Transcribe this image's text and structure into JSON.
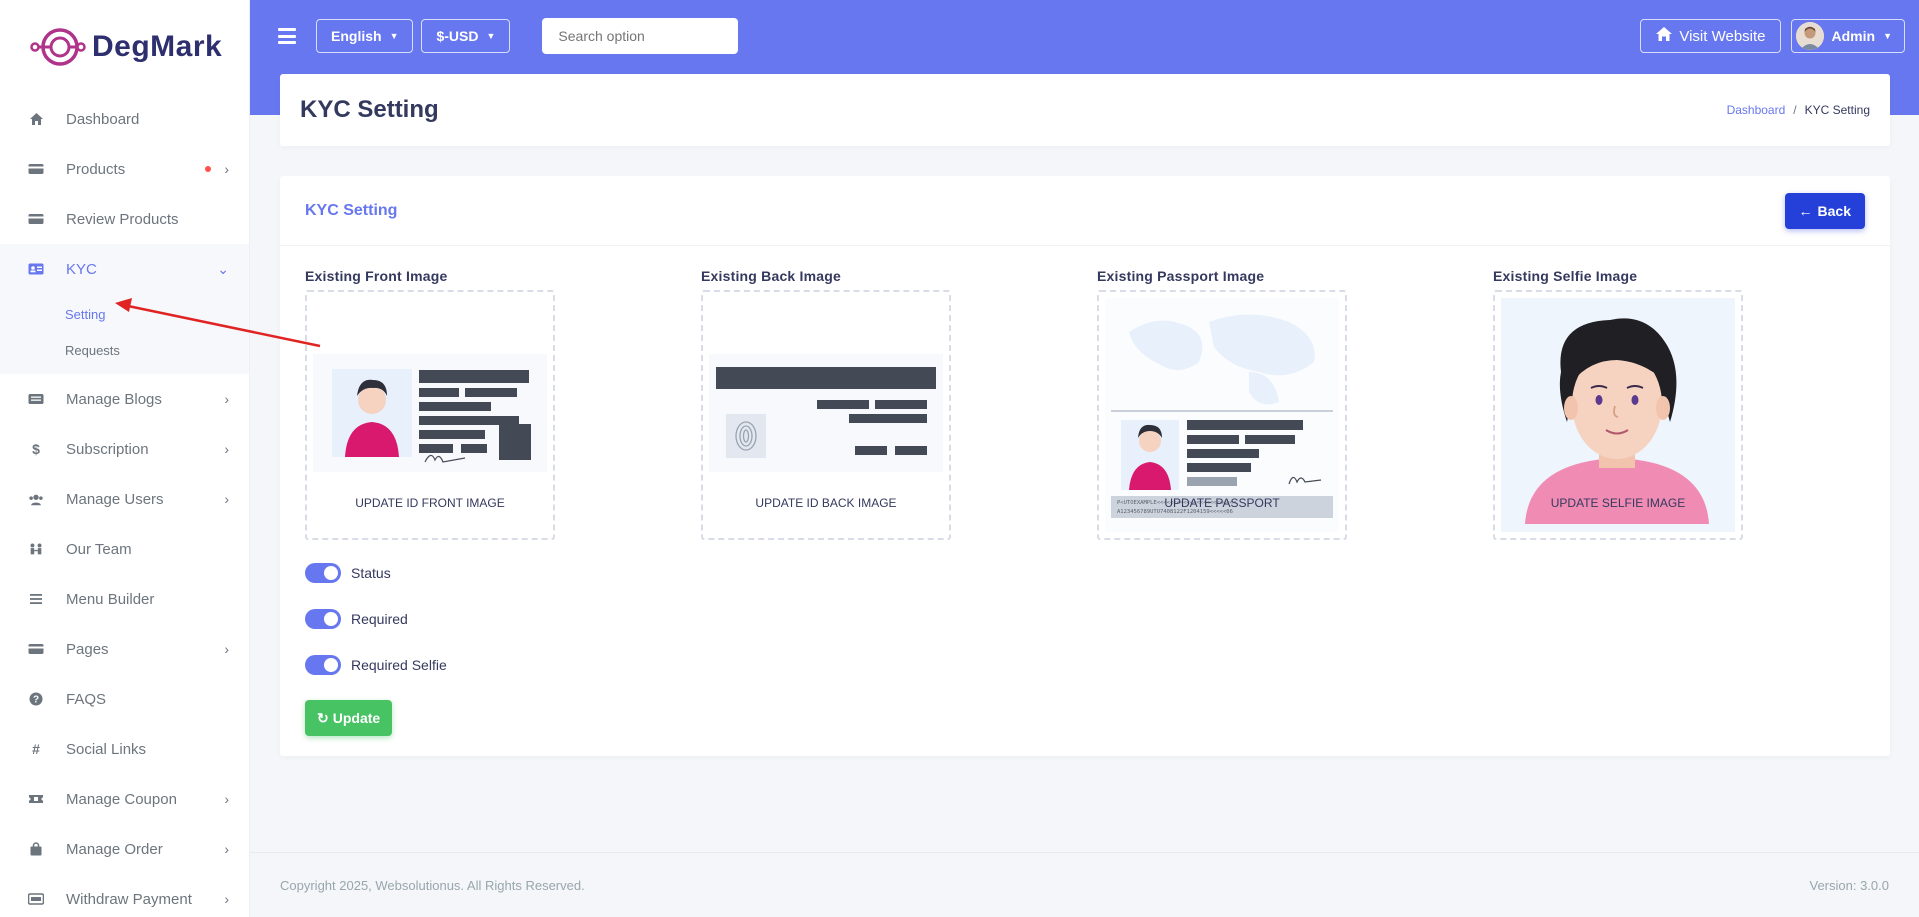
{
  "brand": {
    "name": "DegMark"
  },
  "sidebar": {
    "items": [
      {
        "label": "Dashboard",
        "icon": "home-icon"
      },
      {
        "label": "Products",
        "icon": "card-icon",
        "has_children": true,
        "dot": true
      },
      {
        "label": "Review Products",
        "icon": "card-icon"
      },
      {
        "label": "KYC",
        "icon": "id-card-icon",
        "active": true,
        "expanded": true
      },
      {
        "label": "Manage Blogs",
        "icon": "card-icon",
        "has_children": true
      },
      {
        "label": "Subscription",
        "icon": "dollar-icon",
        "has_children": true
      },
      {
        "label": "Manage Users",
        "icon": "users-icon",
        "has_children": true
      },
      {
        "label": "Our Team",
        "icon": "team-icon"
      },
      {
        "label": "Menu Builder",
        "icon": "bars-icon"
      },
      {
        "label": "Pages",
        "icon": "card-icon",
        "has_children": true
      },
      {
        "label": "FAQS",
        "icon": "question-icon"
      },
      {
        "label": "Social Links",
        "icon": "hash-icon"
      },
      {
        "label": "Manage Coupon",
        "icon": "ticket-icon",
        "has_children": true
      },
      {
        "label": "Manage Order",
        "icon": "bag-icon",
        "has_children": true
      },
      {
        "label": "Withdraw Payment",
        "icon": "wallet-icon",
        "has_children": true
      }
    ],
    "kyc_sub": [
      {
        "label": "Setting",
        "current": true
      },
      {
        "label": "Requests"
      }
    ]
  },
  "navbar": {
    "language": "English",
    "currency": "$-USD",
    "search_placeholder": "Search option",
    "visit_label": "Visit Website",
    "user_label": "Admin"
  },
  "page": {
    "title": "KYC Setting",
    "breadcrumb": {
      "home": "Dashboard",
      "current": "KYC Setting"
    }
  },
  "card": {
    "title": "KYC Setting",
    "back_label": "Back",
    "images": [
      {
        "label": "Existing Front Image",
        "caption": "UPDATE ID FRONT IMAGE"
      },
      {
        "label": "Existing Back Image",
        "caption": "UPDATE ID BACK IMAGE"
      },
      {
        "label": "Existing Passport Image",
        "caption": "UPDATE PASSPORT"
      },
      {
        "label": "Existing Selfie Image",
        "caption": "UPDATE SELFIE IMAGE"
      }
    ],
    "toggles": [
      {
        "label": "Status",
        "on": true
      },
      {
        "label": "Required",
        "on": true
      },
      {
        "label": "Required Selfie",
        "on": true
      }
    ],
    "update_label": "Update"
  },
  "footer": {
    "copyright": "Copyright 2025, Websolutionus. All Rights Reserved.",
    "version": "Version: 3.0.0"
  },
  "colors": {
    "primary": "#6777ef",
    "back_button": "#2440d8",
    "update_button": "#47c363",
    "annotation_arrow": "#e02424"
  }
}
